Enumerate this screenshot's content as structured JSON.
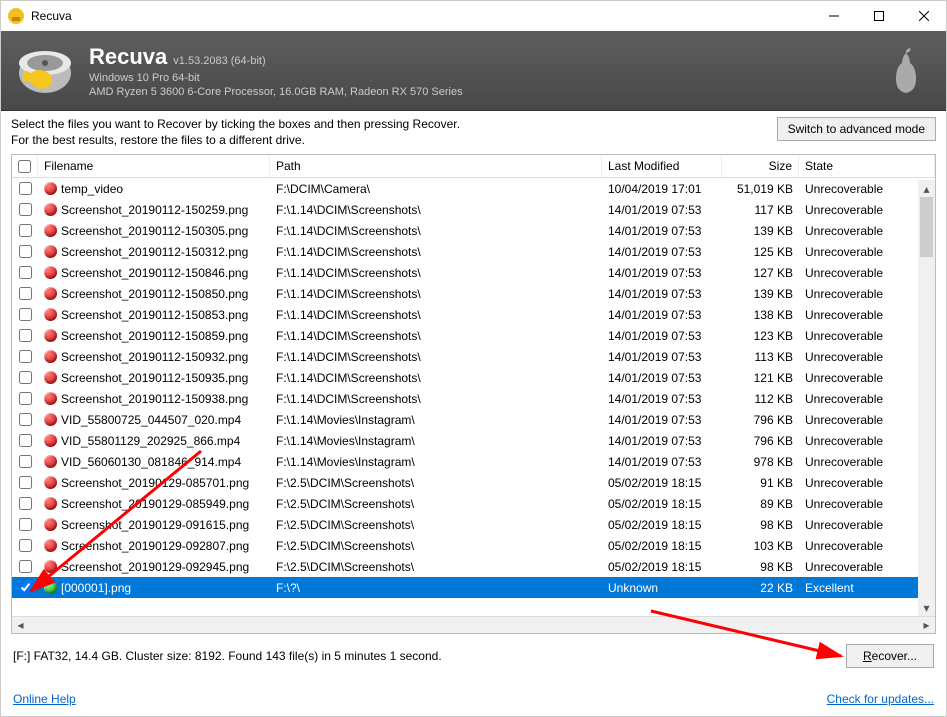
{
  "title": "Recuva",
  "header": {
    "name": "Recuva",
    "version": "v1.53.2083 (64-bit)",
    "os": "Windows 10 Pro 64-bit",
    "hw": "AMD Ryzen 5 3600 6-Core Processor, 16.0GB RAM, Radeon RX 570 Series"
  },
  "instructions": {
    "line1": "Select the files you want to Recover by ticking the boxes and then pressing Recover.",
    "line2": "For the best results, restore the files to a different drive."
  },
  "buttons": {
    "advanced": "Switch to advanced mode",
    "recover": "Recover...",
    "recover_key": "R"
  },
  "columns": {
    "filename": "Filename",
    "path": "Path",
    "modified": "Last Modified",
    "size": "Size",
    "state": "State"
  },
  "rows": [
    {
      "checked": false,
      "status": "red",
      "name": "temp_video",
      "path": "F:\\DCIM\\Camera\\",
      "modified": "10/04/2019 17:01",
      "size": "51,019 KB",
      "state": "Unrecoverable"
    },
    {
      "checked": false,
      "status": "red",
      "name": "Screenshot_20190112-150259.png",
      "path": "F:\\1.14\\DCIM\\Screenshots\\",
      "modified": "14/01/2019 07:53",
      "size": "117 KB",
      "state": "Unrecoverable"
    },
    {
      "checked": false,
      "status": "red",
      "name": "Screenshot_20190112-150305.png",
      "path": "F:\\1.14\\DCIM\\Screenshots\\",
      "modified": "14/01/2019 07:53",
      "size": "139 KB",
      "state": "Unrecoverable"
    },
    {
      "checked": false,
      "status": "red",
      "name": "Screenshot_20190112-150312.png",
      "path": "F:\\1.14\\DCIM\\Screenshots\\",
      "modified": "14/01/2019 07:53",
      "size": "125 KB",
      "state": "Unrecoverable"
    },
    {
      "checked": false,
      "status": "red",
      "name": "Screenshot_20190112-150846.png",
      "path": "F:\\1.14\\DCIM\\Screenshots\\",
      "modified": "14/01/2019 07:53",
      "size": "127 KB",
      "state": "Unrecoverable"
    },
    {
      "checked": false,
      "status": "red",
      "name": "Screenshot_20190112-150850.png",
      "path": "F:\\1.14\\DCIM\\Screenshots\\",
      "modified": "14/01/2019 07:53",
      "size": "139 KB",
      "state": "Unrecoverable"
    },
    {
      "checked": false,
      "status": "red",
      "name": "Screenshot_20190112-150853.png",
      "path": "F:\\1.14\\DCIM\\Screenshots\\",
      "modified": "14/01/2019 07:53",
      "size": "138 KB",
      "state": "Unrecoverable"
    },
    {
      "checked": false,
      "status": "red",
      "name": "Screenshot_20190112-150859.png",
      "path": "F:\\1.14\\DCIM\\Screenshots\\",
      "modified": "14/01/2019 07:53",
      "size": "123 KB",
      "state": "Unrecoverable"
    },
    {
      "checked": false,
      "status": "red",
      "name": "Screenshot_20190112-150932.png",
      "path": "F:\\1.14\\DCIM\\Screenshots\\",
      "modified": "14/01/2019 07:53",
      "size": "113 KB",
      "state": "Unrecoverable"
    },
    {
      "checked": false,
      "status": "red",
      "name": "Screenshot_20190112-150935.png",
      "path": "F:\\1.14\\DCIM\\Screenshots\\",
      "modified": "14/01/2019 07:53",
      "size": "121 KB",
      "state": "Unrecoverable"
    },
    {
      "checked": false,
      "status": "red",
      "name": "Screenshot_20190112-150938.png",
      "path": "F:\\1.14\\DCIM\\Screenshots\\",
      "modified": "14/01/2019 07:53",
      "size": "112 KB",
      "state": "Unrecoverable"
    },
    {
      "checked": false,
      "status": "red",
      "name": "VID_55800725_044507_020.mp4",
      "path": "F:\\1.14\\Movies\\Instagram\\",
      "modified": "14/01/2019 07:53",
      "size": "796 KB",
      "state": "Unrecoverable"
    },
    {
      "checked": false,
      "status": "red",
      "name": "VID_55801129_202925_866.mp4",
      "path": "F:\\1.14\\Movies\\Instagram\\",
      "modified": "14/01/2019 07:53",
      "size": "796 KB",
      "state": "Unrecoverable"
    },
    {
      "checked": false,
      "status": "red",
      "name": "VID_56060130_081846_914.mp4",
      "path": "F:\\1.14\\Movies\\Instagram\\",
      "modified": "14/01/2019 07:53",
      "size": "978 KB",
      "state": "Unrecoverable"
    },
    {
      "checked": false,
      "status": "red",
      "name": "Screenshot_20190129-085701.png",
      "path": "F:\\2.5\\DCIM\\Screenshots\\",
      "modified": "05/02/2019 18:15",
      "size": "91 KB",
      "state": "Unrecoverable"
    },
    {
      "checked": false,
      "status": "red",
      "name": "Screenshot_20190129-085949.png",
      "path": "F:\\2.5\\DCIM\\Screenshots\\",
      "modified": "05/02/2019 18:15",
      "size": "89 KB",
      "state": "Unrecoverable"
    },
    {
      "checked": false,
      "status": "red",
      "name": "Screenshot_20190129-091615.png",
      "path": "F:\\2.5\\DCIM\\Screenshots\\",
      "modified": "05/02/2019 18:15",
      "size": "98 KB",
      "state": "Unrecoverable"
    },
    {
      "checked": false,
      "status": "red",
      "name": "Screenshot_20190129-092807.png",
      "path": "F:\\2.5\\DCIM\\Screenshots\\",
      "modified": "05/02/2019 18:15",
      "size": "103 KB",
      "state": "Unrecoverable"
    },
    {
      "checked": false,
      "status": "red",
      "name": "Screenshot_20190129-092945.png",
      "path": "F:\\2.5\\DCIM\\Screenshots\\",
      "modified": "05/02/2019 18:15",
      "size": "98 KB",
      "state": "Unrecoverable"
    },
    {
      "checked": true,
      "selected": true,
      "status": "green",
      "name": "[000001].png",
      "path": "F:\\?\\",
      "modified": "Unknown",
      "size": "22 KB",
      "state": "Excellent"
    }
  ],
  "status_line": "[F:] FAT32, 14.4 GB. Cluster size: 8192. Found 143 file(s) in 5 minutes 1 second.",
  "footer": {
    "help": "Online Help",
    "updates": "Check for updates..."
  }
}
